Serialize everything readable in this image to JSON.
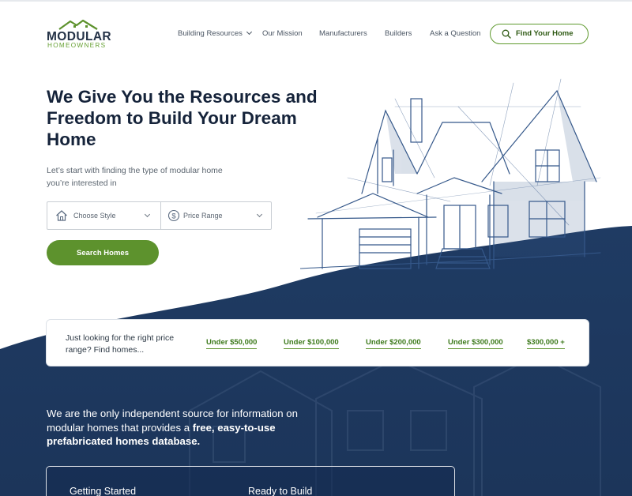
{
  "brand": {
    "name": "MODULAR",
    "tagline": "HOMEOWNERS"
  },
  "nav": {
    "items": [
      {
        "label": "Building Resources",
        "has_dropdown": true
      },
      {
        "label": "Our Mission"
      },
      {
        "label": "Manufacturers"
      },
      {
        "label": "Builders"
      },
      {
        "label": "Ask a Question"
      }
    ],
    "cta": "Find Your Home"
  },
  "hero": {
    "title": "We Give You the Resources and Freedom to Build Your Dream Home",
    "subtitle": "Let’s start with finding the type of modular home you’re interested in",
    "select_style": "Choose Style",
    "select_price": "Price Range",
    "search_button": "Search Homes"
  },
  "price_ranges": {
    "prompt": "Just looking for the right price range? Find homes...",
    "links": [
      "Under $50,000",
      "Under $100,000",
      "Under $200,000",
      "Under $300,000",
      "$300,000 +"
    ]
  },
  "info": {
    "text_plain": "We are the only independent source for information on modular homes that provides a ",
    "text_bold": "free, easy-to-use prefabricated homes database."
  },
  "panel": {
    "col1": "Getting Started",
    "col2": "Ready to Build"
  },
  "colors": {
    "brand_green": "#5d922d",
    "navy": "#1f3b63",
    "heading": "#15233a"
  },
  "icons": [
    "house-logo-icon",
    "search-icon",
    "home-icon",
    "dollar-icon",
    "chevron-down-icon"
  ]
}
